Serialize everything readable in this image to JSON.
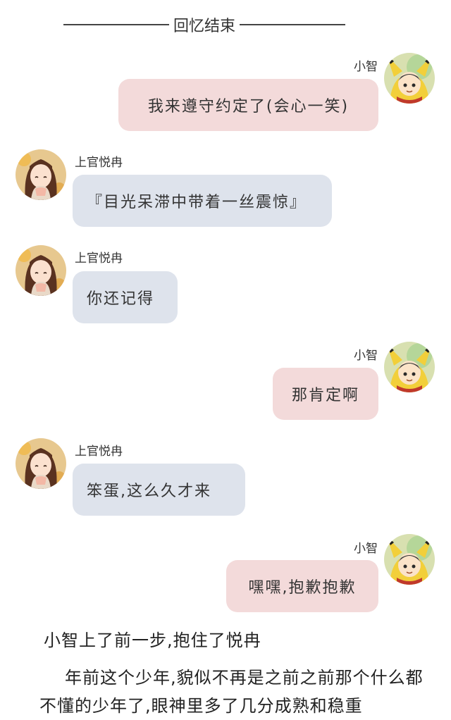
{
  "divider": {
    "label": "回忆结束"
  },
  "colors": {
    "right_bubble": "#f3dada",
    "left_bubble": "#dee3ec",
    "text": "#333333",
    "background": "#ffffff"
  },
  "messages": [
    {
      "side": "right",
      "sender": "小智",
      "text": "我来遵守约定了(会心一笑)",
      "avatar": "pikachu-hood-boy-avatar"
    },
    {
      "side": "left",
      "sender": "上官悦冉",
      "text": "『目光呆滞中带着一丝震惊』",
      "avatar": "brown-hair-girl-avatar"
    },
    {
      "side": "left",
      "sender": "上官悦冉",
      "text": "你还记得",
      "avatar": "brown-hair-girl-avatar"
    },
    {
      "side": "right",
      "sender": "小智",
      "text": "那肯定啊",
      "avatar": "pikachu-hood-boy-avatar"
    },
    {
      "side": "left",
      "sender": "上官悦冉",
      "text": "笨蛋,这么久才来",
      "avatar": "brown-hair-girl-avatar"
    },
    {
      "side": "right",
      "sender": "小智",
      "text": "嘿嘿,抱歉抱歉",
      "avatar": "pikachu-hood-boy-avatar"
    }
  ],
  "narration": "小智上了前一步,抱住了悦冉",
  "paragraph": "年前这个少年,貌似不再是之前之前那个什么都不懂的少年了,眼神里多了几分成熟和稳重"
}
